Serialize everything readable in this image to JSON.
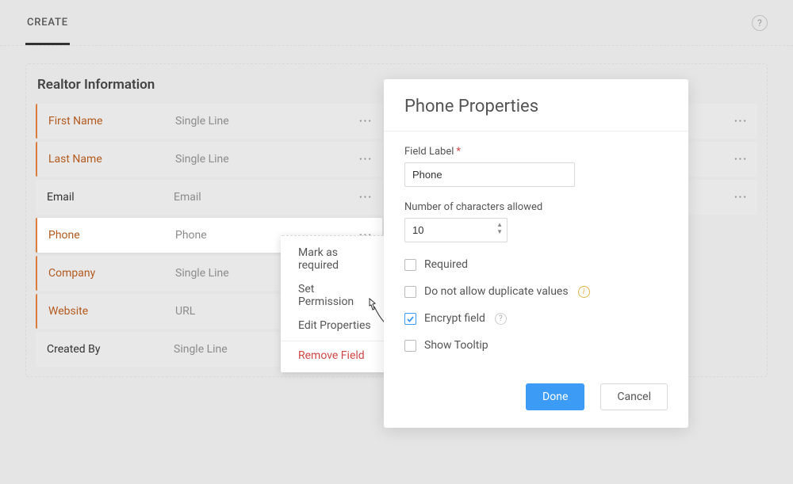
{
  "top": {
    "tab_label": "CREATE"
  },
  "section": {
    "title": "Realtor Information"
  },
  "fields": [
    {
      "label": "First Name",
      "type": "Single Line",
      "accent": true,
      "selected": false
    },
    {
      "label": "Last Name",
      "type": "Single Line",
      "accent": true,
      "selected": false
    },
    {
      "label": "Email",
      "type": "Email",
      "accent": false,
      "selected": false
    },
    {
      "label": "Phone",
      "type": "Phone",
      "accent": true,
      "selected": true
    },
    {
      "label": "Company",
      "type": "Single Line",
      "accent": true,
      "selected": false
    },
    {
      "label": "Website",
      "type": "URL",
      "accent": true,
      "selected": false
    },
    {
      "label": "Created By",
      "type": "Single Line",
      "accent": false,
      "selected": false
    }
  ],
  "context_menu": {
    "items": {
      "mark_required": "Mark as required",
      "set_permission": "Set Permission",
      "edit_properties": "Edit Properties",
      "remove_field": "Remove Field"
    }
  },
  "modal": {
    "title": "Phone Properties",
    "field_label_label": "Field Label",
    "field_label_value": "Phone",
    "char_count_label": "Number of characters allowed",
    "char_count_value": "10",
    "required_label": "Required",
    "no_dupe_label": "Do not allow duplicate values",
    "encrypt_label": "Encrypt field",
    "tooltip_label": "Show Tooltip",
    "done_label": "Done",
    "cancel_label": "Cancel"
  }
}
